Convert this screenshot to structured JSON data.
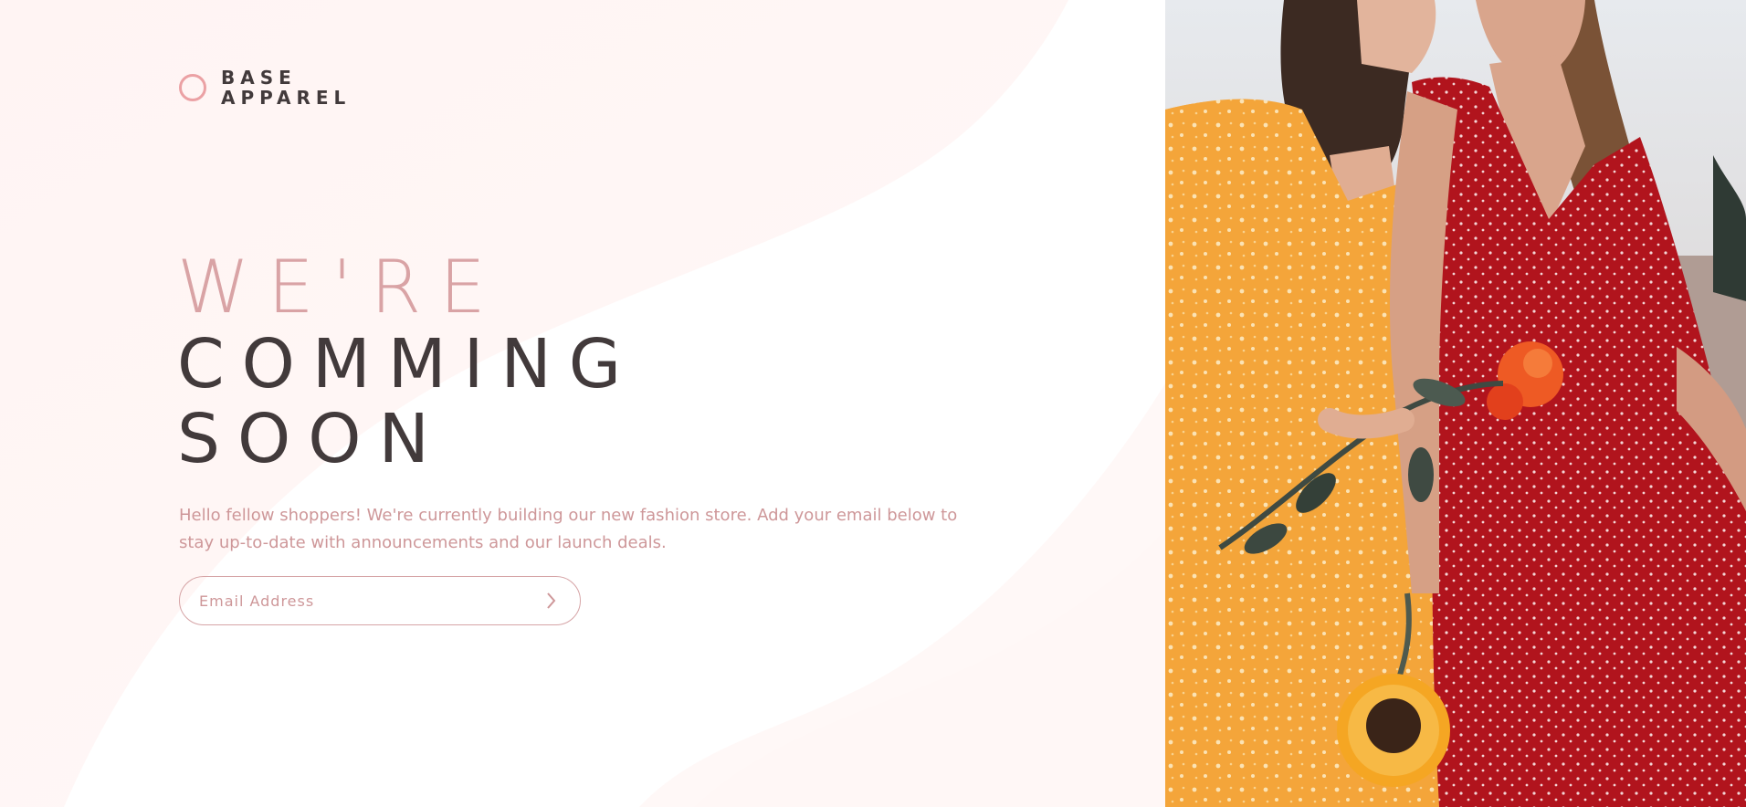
{
  "brand": {
    "line1": "BASE",
    "line2": "APPAREL"
  },
  "hero": {
    "headline_light": "WE'RE",
    "headline_line2": "COMMING",
    "headline_line3": "SOON",
    "intro": "Hello fellow shoppers! We're currently building our new fashion store. Add your email below to stay up-to-date with announcements and our launch deals."
  },
  "signup": {
    "placeholder": "Email Address",
    "submit_icon": "chevron-right-icon"
  },
  "hero_image": {
    "subject": "two women in an orange floral dress and a red polka-dot dress holding flowers"
  },
  "colors": {
    "accent": "#ce9799",
    "accent_light": "#eba1a4",
    "text_dark": "#423a3b",
    "background": "#fff6f5"
  }
}
